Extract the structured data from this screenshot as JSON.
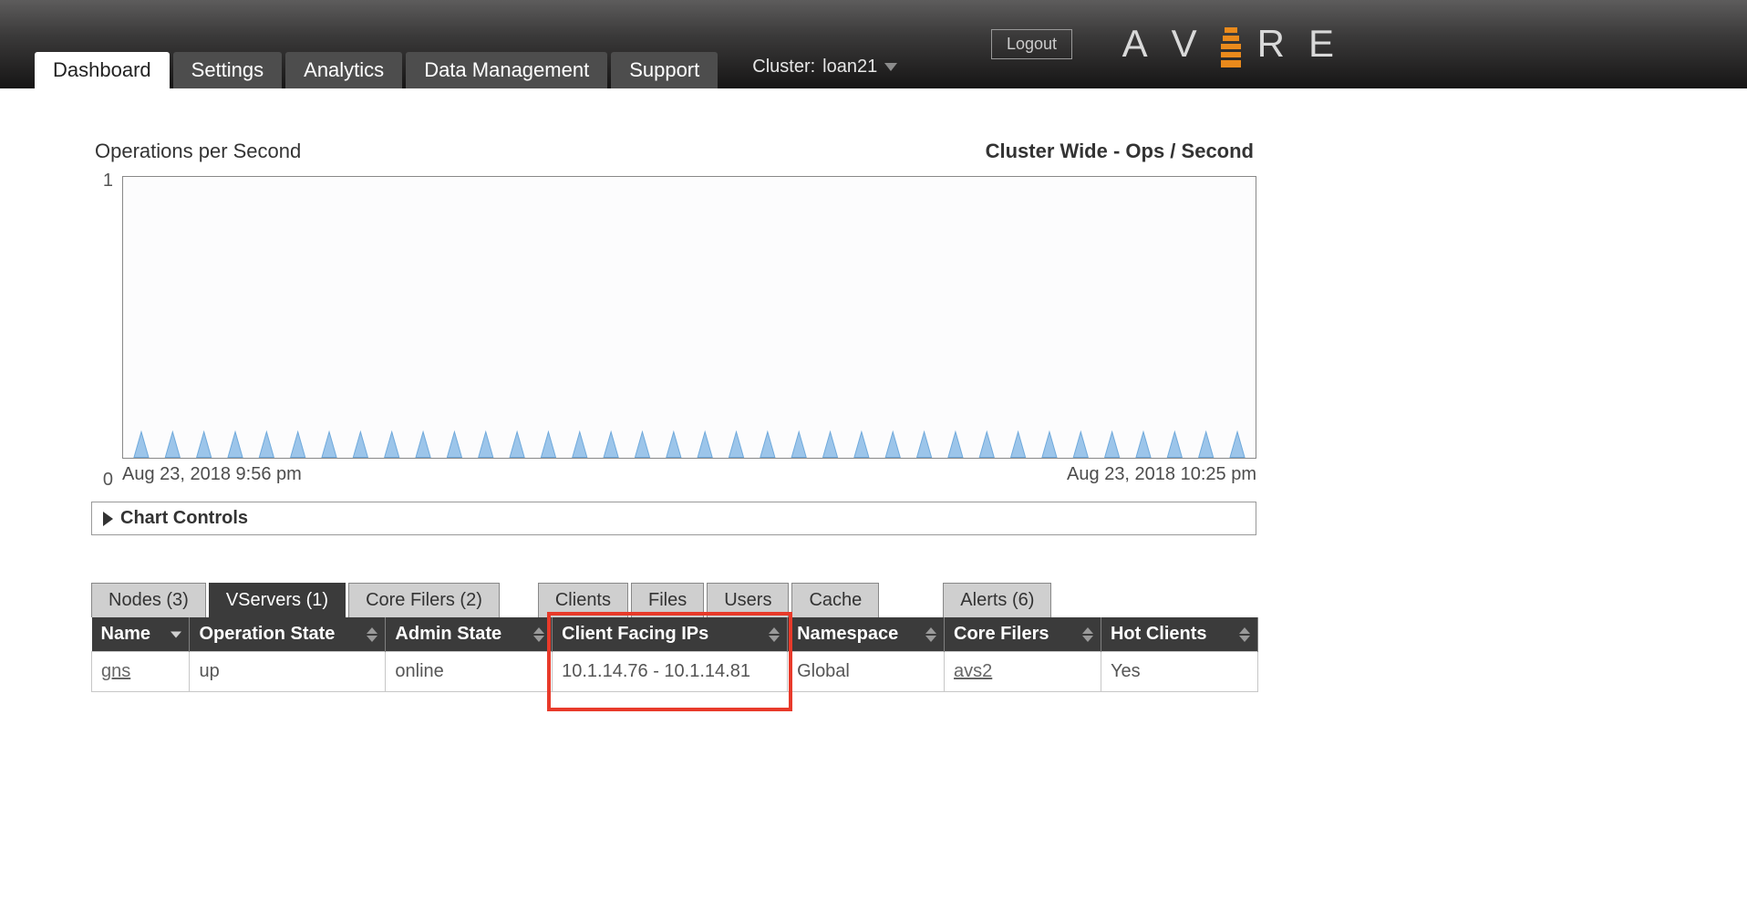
{
  "header": {
    "logout_label": "Logout",
    "logo_letters": "AVERE",
    "nav": {
      "dashboard": "Dashboard",
      "settings": "Settings",
      "analytics": "Analytics",
      "data_mgmt": "Data Management",
      "support": "Support"
    },
    "cluster_prefix": "Cluster:",
    "cluster_name": "loan21"
  },
  "chart": {
    "title_left": "Operations per Second",
    "title_right": "Cluster Wide - Ops / Second",
    "y_top": "1",
    "y_bot": "0",
    "x_start": "Aug 23, 2018 9:56 pm",
    "x_end": "Aug 23, 2018 10:25 pm"
  },
  "controls_label": "Chart Controls",
  "dtabs": {
    "nodes": "Nodes (3)",
    "vservers": "VServers (1)",
    "corefilers": "Core Filers (2)",
    "clients": "Clients",
    "files": "Files",
    "users": "Users",
    "cache": "Cache",
    "alerts": "Alerts (6)"
  },
  "table": {
    "headers": {
      "name": "Name",
      "opstate": "Operation State",
      "adminstate": "Admin State",
      "cfip": "Client Facing IPs",
      "ns": "Namespace",
      "cf": "Core Filers",
      "hot": "Hot Clients"
    },
    "rows": [
      {
        "name": "gns",
        "opstate": "up",
        "adminstate": "online",
        "cfip": "10.1.14.76 - 10.1.14.81",
        "ns": "Global",
        "cf": "avs2",
        "hot": "Yes"
      }
    ]
  },
  "chart_data": {
    "type": "line",
    "title": "Operations per Second — Cluster Wide - Ops / Second",
    "xlabel": "",
    "ylabel": "",
    "ylim": [
      0,
      1
    ],
    "x_start": "Aug 23, 2018 9:56 pm",
    "x_end": "Aug 23, 2018 10:25 pm",
    "series": [
      {
        "name": "ops_per_sec",
        "note": "Approximate periodic spikes near 0 visible across the interval; exact values not labeled.",
        "samples": 36,
        "peak_value_estimate": 0.05
      }
    ]
  }
}
